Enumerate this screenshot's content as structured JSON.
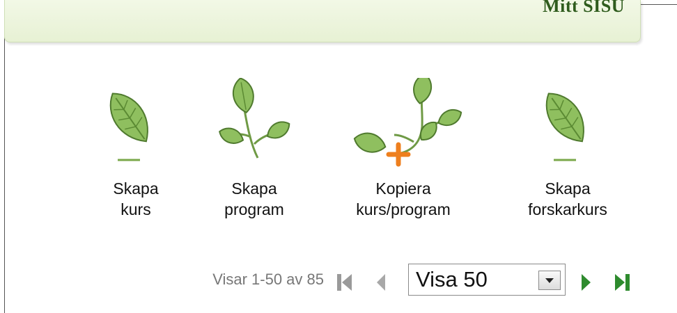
{
  "header": {
    "title": "Mitt SISU"
  },
  "actions": [
    {
      "label_line1": "Skapa",
      "label_line2": "kurs",
      "icon": "leaf-icon"
    },
    {
      "label_line1": "Skapa",
      "label_line2": "program",
      "icon": "leaf-branch-icon"
    },
    {
      "label_line1": "Kopiera",
      "label_line2": "kurs/program",
      "icon": "leaf-branch-plus-icon"
    },
    {
      "label_line1": "Skapa",
      "label_line2": "forskarkurs",
      "icon": "leaf-icon"
    }
  ],
  "pager": {
    "info": "Visar 1-50 av 85",
    "page_size_selected": "Visa 50"
  },
  "colors": {
    "header_text": "#2f5c1d",
    "header_bg": "#eaf3d9",
    "pager_arrow": "#2e8b2e"
  }
}
